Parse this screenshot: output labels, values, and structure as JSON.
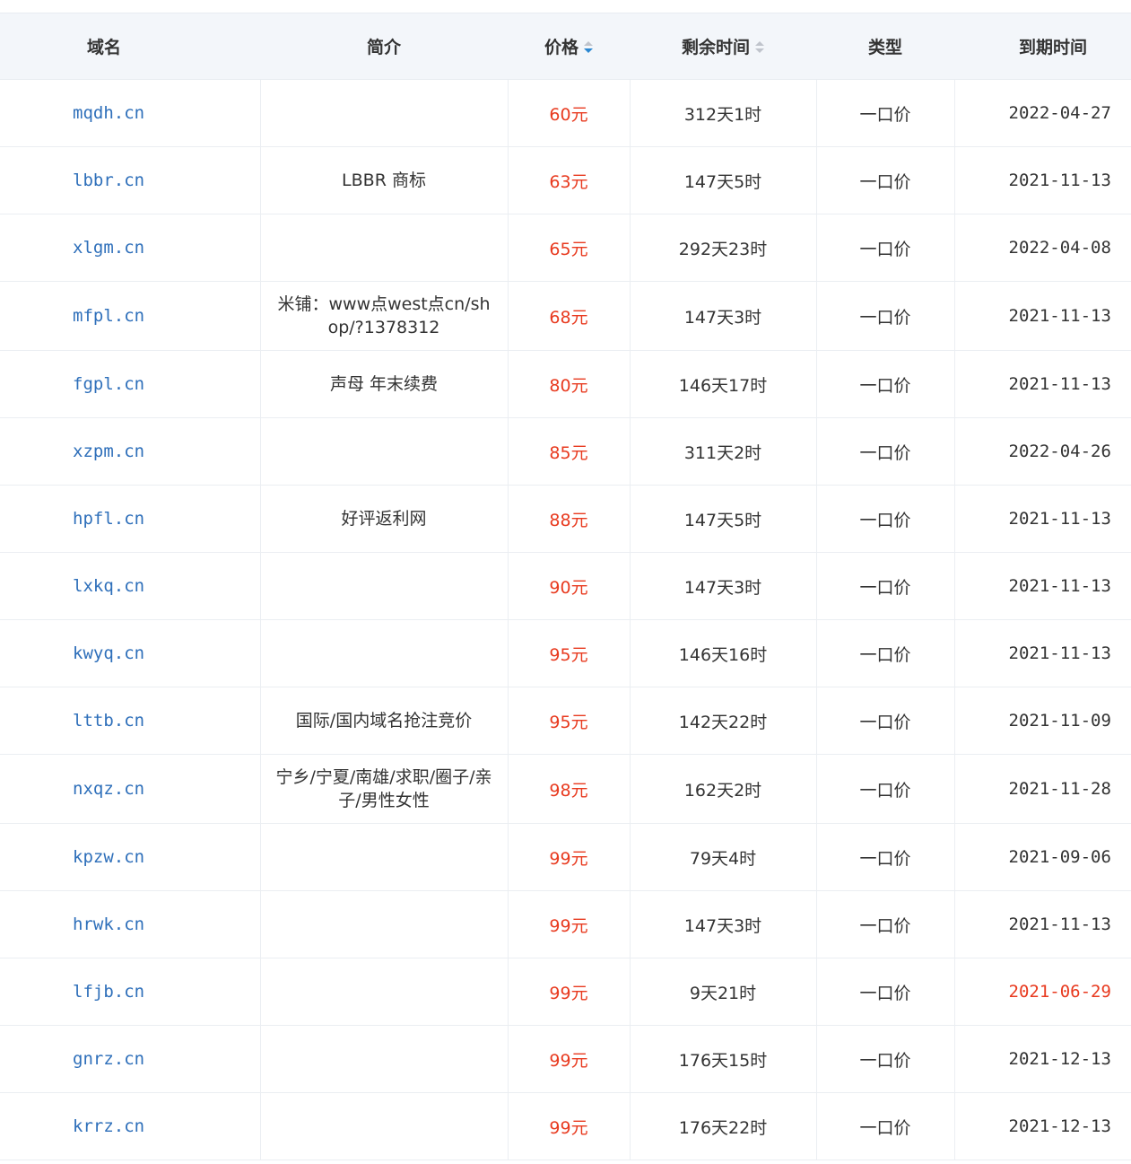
{
  "header": {
    "name": "域名",
    "desc": "简介",
    "price": "价格",
    "remain": "剩余时间",
    "type": "类型",
    "expire": "到期时间"
  },
  "colors": {
    "link": "#2e6fba",
    "price": "#e83a1f",
    "urgent": "#e83a1f",
    "sort_active": "#2b87d1",
    "header_bg": "#f3f6fa"
  },
  "rows": [
    {
      "domain": "mqdh.cn",
      "desc": "",
      "price": "60元",
      "remain": "312天1时",
      "type": "一口价",
      "expire": "2022-04-27",
      "urgent": false
    },
    {
      "domain": "lbbr.cn",
      "desc": "LBBR 商标",
      "price": "63元",
      "remain": "147天5时",
      "type": "一口价",
      "expire": "2021-11-13",
      "urgent": false
    },
    {
      "domain": "xlgm.cn",
      "desc": "",
      "price": "65元",
      "remain": "292天23时",
      "type": "一口价",
      "expire": "2022-04-08",
      "urgent": false
    },
    {
      "domain": "mfpl.cn",
      "desc": "米铺：www点west点cn/shop/?1378312",
      "price": "68元",
      "remain": "147天3时",
      "type": "一口价",
      "expire": "2021-11-13",
      "urgent": false
    },
    {
      "domain": "fgpl.cn",
      "desc": "声母 年末续费",
      "price": "80元",
      "remain": "146天17时",
      "type": "一口价",
      "expire": "2021-11-13",
      "urgent": false
    },
    {
      "domain": "xzpm.cn",
      "desc": "",
      "price": "85元",
      "remain": "311天2时",
      "type": "一口价",
      "expire": "2022-04-26",
      "urgent": false
    },
    {
      "domain": "hpfl.cn",
      "desc": "好评返利网",
      "price": "88元",
      "remain": "147天5时",
      "type": "一口价",
      "expire": "2021-11-13",
      "urgent": false
    },
    {
      "domain": "lxkq.cn",
      "desc": "",
      "price": "90元",
      "remain": "147天3时",
      "type": "一口价",
      "expire": "2021-11-13",
      "urgent": false
    },
    {
      "domain": "kwyq.cn",
      "desc": "",
      "price": "95元",
      "remain": "146天16时",
      "type": "一口价",
      "expire": "2021-11-13",
      "urgent": false
    },
    {
      "domain": "lttb.cn",
      "desc": "国际/国内域名抢注竞价",
      "price": "95元",
      "remain": "142天22时",
      "type": "一口价",
      "expire": "2021-11-09",
      "urgent": false
    },
    {
      "domain": "nxqz.cn",
      "desc": "宁乡/宁夏/南雄/求职/圈子/亲子/男性女性",
      "price": "98元",
      "remain": "162天2时",
      "type": "一口价",
      "expire": "2021-11-28",
      "urgent": false
    },
    {
      "domain": "kpzw.cn",
      "desc": "",
      "price": "99元",
      "remain": "79天4时",
      "type": "一口价",
      "expire": "2021-09-06",
      "urgent": false
    },
    {
      "domain": "hrwk.cn",
      "desc": "",
      "price": "99元",
      "remain": "147天3时",
      "type": "一口价",
      "expire": "2021-11-13",
      "urgent": false
    },
    {
      "domain": "lfjb.cn",
      "desc": "",
      "price": "99元",
      "remain": "9天21时",
      "type": "一口价",
      "expire": "2021-06-29",
      "urgent": true
    },
    {
      "domain": "gnrz.cn",
      "desc": "",
      "price": "99元",
      "remain": "176天15时",
      "type": "一口价",
      "expire": "2021-12-13",
      "urgent": false
    },
    {
      "domain": "krrz.cn",
      "desc": "",
      "price": "99元",
      "remain": "176天22时",
      "type": "一口价",
      "expire": "2021-12-13",
      "urgent": false
    }
  ]
}
